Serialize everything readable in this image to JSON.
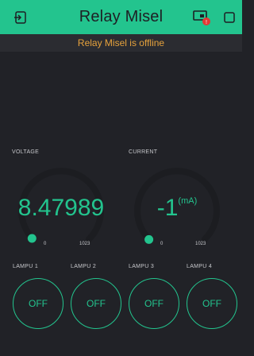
{
  "header": {
    "title": "Relay Misel",
    "left_icon": "exit-layout-icon",
    "device_icon": "device-icon",
    "play_icon": "play-square-icon",
    "badge_color": "#e53935"
  },
  "status": {
    "offline_text": "Relay Misel is offline"
  },
  "gauges": [
    {
      "label": "VOLTAGE",
      "value": "8.47989",
      "unit": "",
      "min": "0",
      "max": "1023",
      "fraction": 0.008
    },
    {
      "label": "CURRENT",
      "value": "-1",
      "unit": "(mA)",
      "min": "0",
      "max": "1023",
      "fraction": 0.0
    }
  ],
  "lamps": [
    {
      "label": "LAMPU 1",
      "state": "OFF"
    },
    {
      "label": "LAMPU 2",
      "state": "OFF"
    },
    {
      "label": "LAMPU 3",
      "state": "OFF"
    },
    {
      "label": "LAMPU 4",
      "state": "OFF"
    }
  ],
  "colors": {
    "accent": "#23c48e",
    "background": "#212227",
    "warning": "#e6a23c"
  }
}
